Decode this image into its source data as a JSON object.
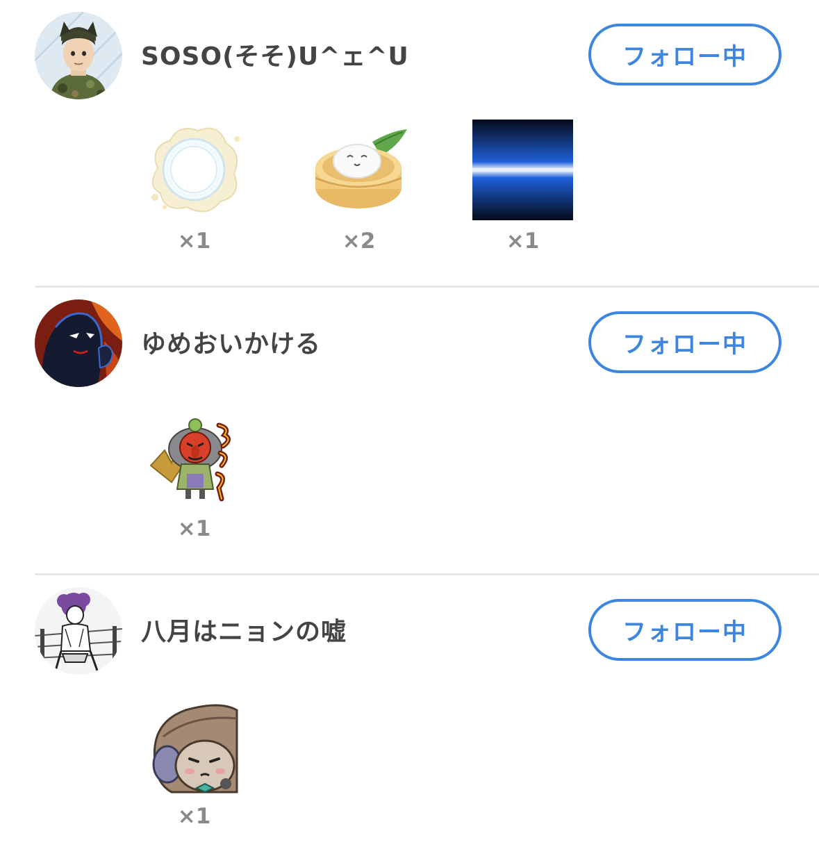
{
  "follow_label": "フォロー中",
  "colors": {
    "accent": "#3d86e0",
    "username": "#444444",
    "count": "#8a8a8a",
    "divider": "#e6e6e6"
  },
  "users": [
    {
      "name": "SOSO(そそ)U^ェ^U",
      "avatar_icon": "soldier-avatar-icon",
      "stickers": [
        {
          "icon": "splash-plate-sticker-icon",
          "count": "×1"
        },
        {
          "icon": "steamed-bun-sticker-icon",
          "count": "×2"
        },
        {
          "icon": "blue-light-beam-sticker-icon",
          "count": "×1"
        }
      ]
    },
    {
      "name": "ゆめおいかける",
      "avatar_icon": "shadow-figure-avatar-icon",
      "stickers": [
        {
          "icon": "tengu-sticker-icon",
          "count": "×1"
        }
      ]
    },
    {
      "name": "八月はニョンの嘘",
      "avatar_icon": "manga-boxer-avatar-icon",
      "stickers": [
        {
          "icon": "hooded-creature-sticker-icon",
          "count": "×1"
        }
      ]
    }
  ]
}
